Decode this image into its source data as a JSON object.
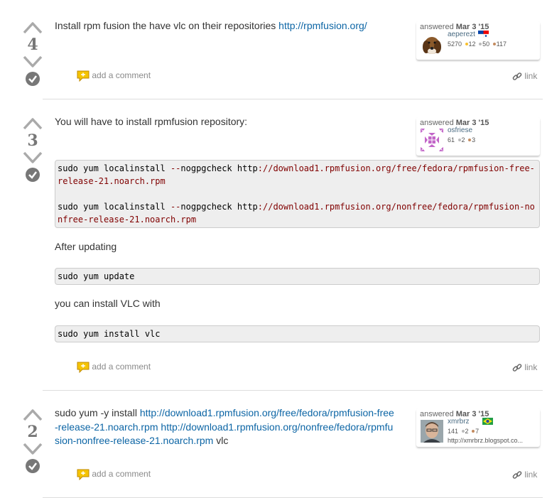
{
  "answers": [
    {
      "votes": "4",
      "body_text": "Install rpm fusion the have vlc on their repositories ",
      "body_link": "http://rpmfusion.org/",
      "answered_label": "answered",
      "answered_date": "Mar 3 '15",
      "user": {
        "name": "aeperezt",
        "rep": "5270",
        "gold": "12",
        "silver": "50",
        "bronze": "117"
      },
      "add_comment": "add a comment",
      "link_label": "link"
    },
    {
      "votes": "3",
      "intro": "You will have to install rpmfusion repository:",
      "code1_cmd": "sudo yum localinstall ",
      "code1_op": "--",
      "code1_mid": "nogpgcheck http",
      "code1_url": "://download1.rpmfusion.org/free/fedora/rpmfusion-free-release-21.noarch.rpm",
      "code2_cmd": "sudo yum localinstall ",
      "code2_op": "--",
      "code2_mid": "nogpgcheck http",
      "code2_url": "://download1.rpmfusion.org/nonfree/fedora/rpmfusion-nonfree-release-21.noarch.rpm",
      "after": "After updating",
      "code_update": "sudo yum update",
      "then": "you can install VLC with",
      "code_install": "sudo yum install vlc",
      "answered_label": "answered",
      "answered_date": "Mar 3 '15",
      "user": {
        "name": "osfriese",
        "rep": "61",
        "silver": "2",
        "bronze": "3"
      },
      "add_comment": "add a comment",
      "link_label": "link"
    },
    {
      "votes": "2",
      "prefix": "sudo yum -y install ",
      "link1": "http://download1.rpmfusion.org/free/fedora/rpmfusion-free-release-21.noarch.rpm",
      "link2": "http://download1.rpmfusion.org/nonfree/fedora/rpmfusion-nonfree-release-21.noarch.rpm",
      "suffix": " vlc",
      "answered_label": "answered",
      "answered_date": "Mar 3 '15",
      "user": {
        "name": "xmrbrz",
        "rep": "141",
        "silver": "2",
        "bronze": "7",
        "website": "http://xmrbrz.blogspot.co..."
      },
      "add_comment": "add a comment",
      "link_label": "link"
    }
  ],
  "colors": {
    "link": "#0c65a5",
    "vote_count": "#777777",
    "code_bg": "#eeeeee",
    "string": "#800000"
  },
  "icons": [
    "vote-up-icon",
    "vote-down-icon",
    "accept-check-icon",
    "comment-bubble-icon",
    "link-chain-icon",
    "flag-icon"
  ]
}
